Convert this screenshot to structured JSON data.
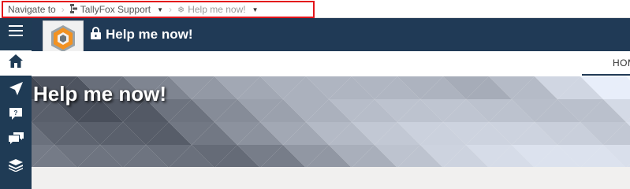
{
  "breadcrumb": {
    "root_label": "Navigate to",
    "site_label": "TallyFox Support",
    "page_label": "Help me now!"
  },
  "header": {
    "title": "Help me now!"
  },
  "tabs": {
    "home_label": "HOME"
  },
  "banner": {
    "title": "Help me now!"
  },
  "icons": {
    "menu": "hamburger-icon",
    "home": "home-icon",
    "navigate": "paper-plane-icon",
    "help": "question-bubble-icon",
    "chat": "chat-bubbles-icon",
    "book": "book-stack-icon",
    "lock": "lock-icon",
    "logo": "tallyfox-logo"
  },
  "colors": {
    "rail": "#1f3b55",
    "header": "#203a56",
    "highlight": "#e3141b",
    "logo_orange": "#f29222"
  }
}
